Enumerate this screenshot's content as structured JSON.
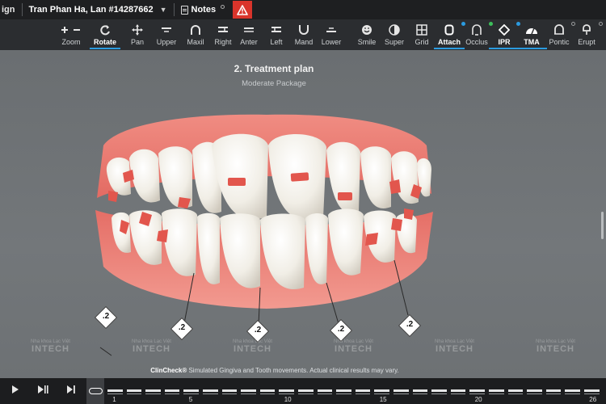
{
  "topbar": {
    "brand": "ign",
    "patient": "Tran Phan Ha, Lan #14287662",
    "notes_label": "Notes"
  },
  "toolbar": {
    "tools": [
      {
        "label": "Zoom",
        "icon": "zoom-plus-minus-icon"
      },
      {
        "label": "Rotate",
        "icon": "rotate-icon",
        "active": true
      },
      {
        "label": "Pan",
        "icon": "pan-arrows-icon"
      },
      {
        "label": "Upper",
        "icon": "upper-jaw-icon"
      },
      {
        "label": "Maxil",
        "icon": "maxillary-arch-icon"
      },
      {
        "label": "Right",
        "icon": "right-view-icon"
      },
      {
        "label": "Anter",
        "icon": "anterior-view-icon"
      },
      {
        "label": "Left",
        "icon": "left-view-icon"
      },
      {
        "label": "Mand",
        "icon": "mandibular-arch-icon"
      },
      {
        "label": "Lower",
        "icon": "lower-jaw-icon"
      },
      {
        "label": "Smile",
        "icon": "smile-icon"
      },
      {
        "label": "Super",
        "icon": "superimpose-icon"
      },
      {
        "label": "Grid",
        "icon": "grid-icon"
      },
      {
        "label": "Attach",
        "icon": "attachment-icon",
        "active": true,
        "dot_color": "#2b9be0"
      },
      {
        "label": "Occlus",
        "icon": "occlusion-icon",
        "dot_color": "#3cbf5a"
      },
      {
        "label": "IPR",
        "icon": "ipr-diamond-icon",
        "active": true,
        "dot_color": "#2b9be0"
      },
      {
        "label": "TMA",
        "icon": "tooth-movement-assessment-icon",
        "active": true
      },
      {
        "label": "Pontic",
        "icon": "pontic-icon",
        "dot_color": "#9a9c9e"
      },
      {
        "label": "Erupt",
        "icon": "eruption-icon",
        "dot_color": "#9a9c9e"
      }
    ]
  },
  "viewport": {
    "title": "2. Treatment plan",
    "subtitle": "Moderate Package",
    "ipr_values": [
      ".2",
      ".2",
      ".2",
      ".2",
      ".2"
    ],
    "watermark_small": "Nha khoa Lạc Việt",
    "watermark_big": "INTECH",
    "disclaimer_brand": "ClinCheck®",
    "disclaimer_text": " Simulated Gingiva and Tooth movements. Actual clinical results may vary."
  },
  "timeline": {
    "stage_labels": [
      "1",
      "5",
      "10",
      "15",
      "20",
      "26"
    ],
    "total_stages": 26,
    "current_stage": 0
  },
  "colors": {
    "accent": "#2b9be0",
    "warning": "#d9342b",
    "gingiva": "#e8736a",
    "attachment": "#e2564d"
  }
}
